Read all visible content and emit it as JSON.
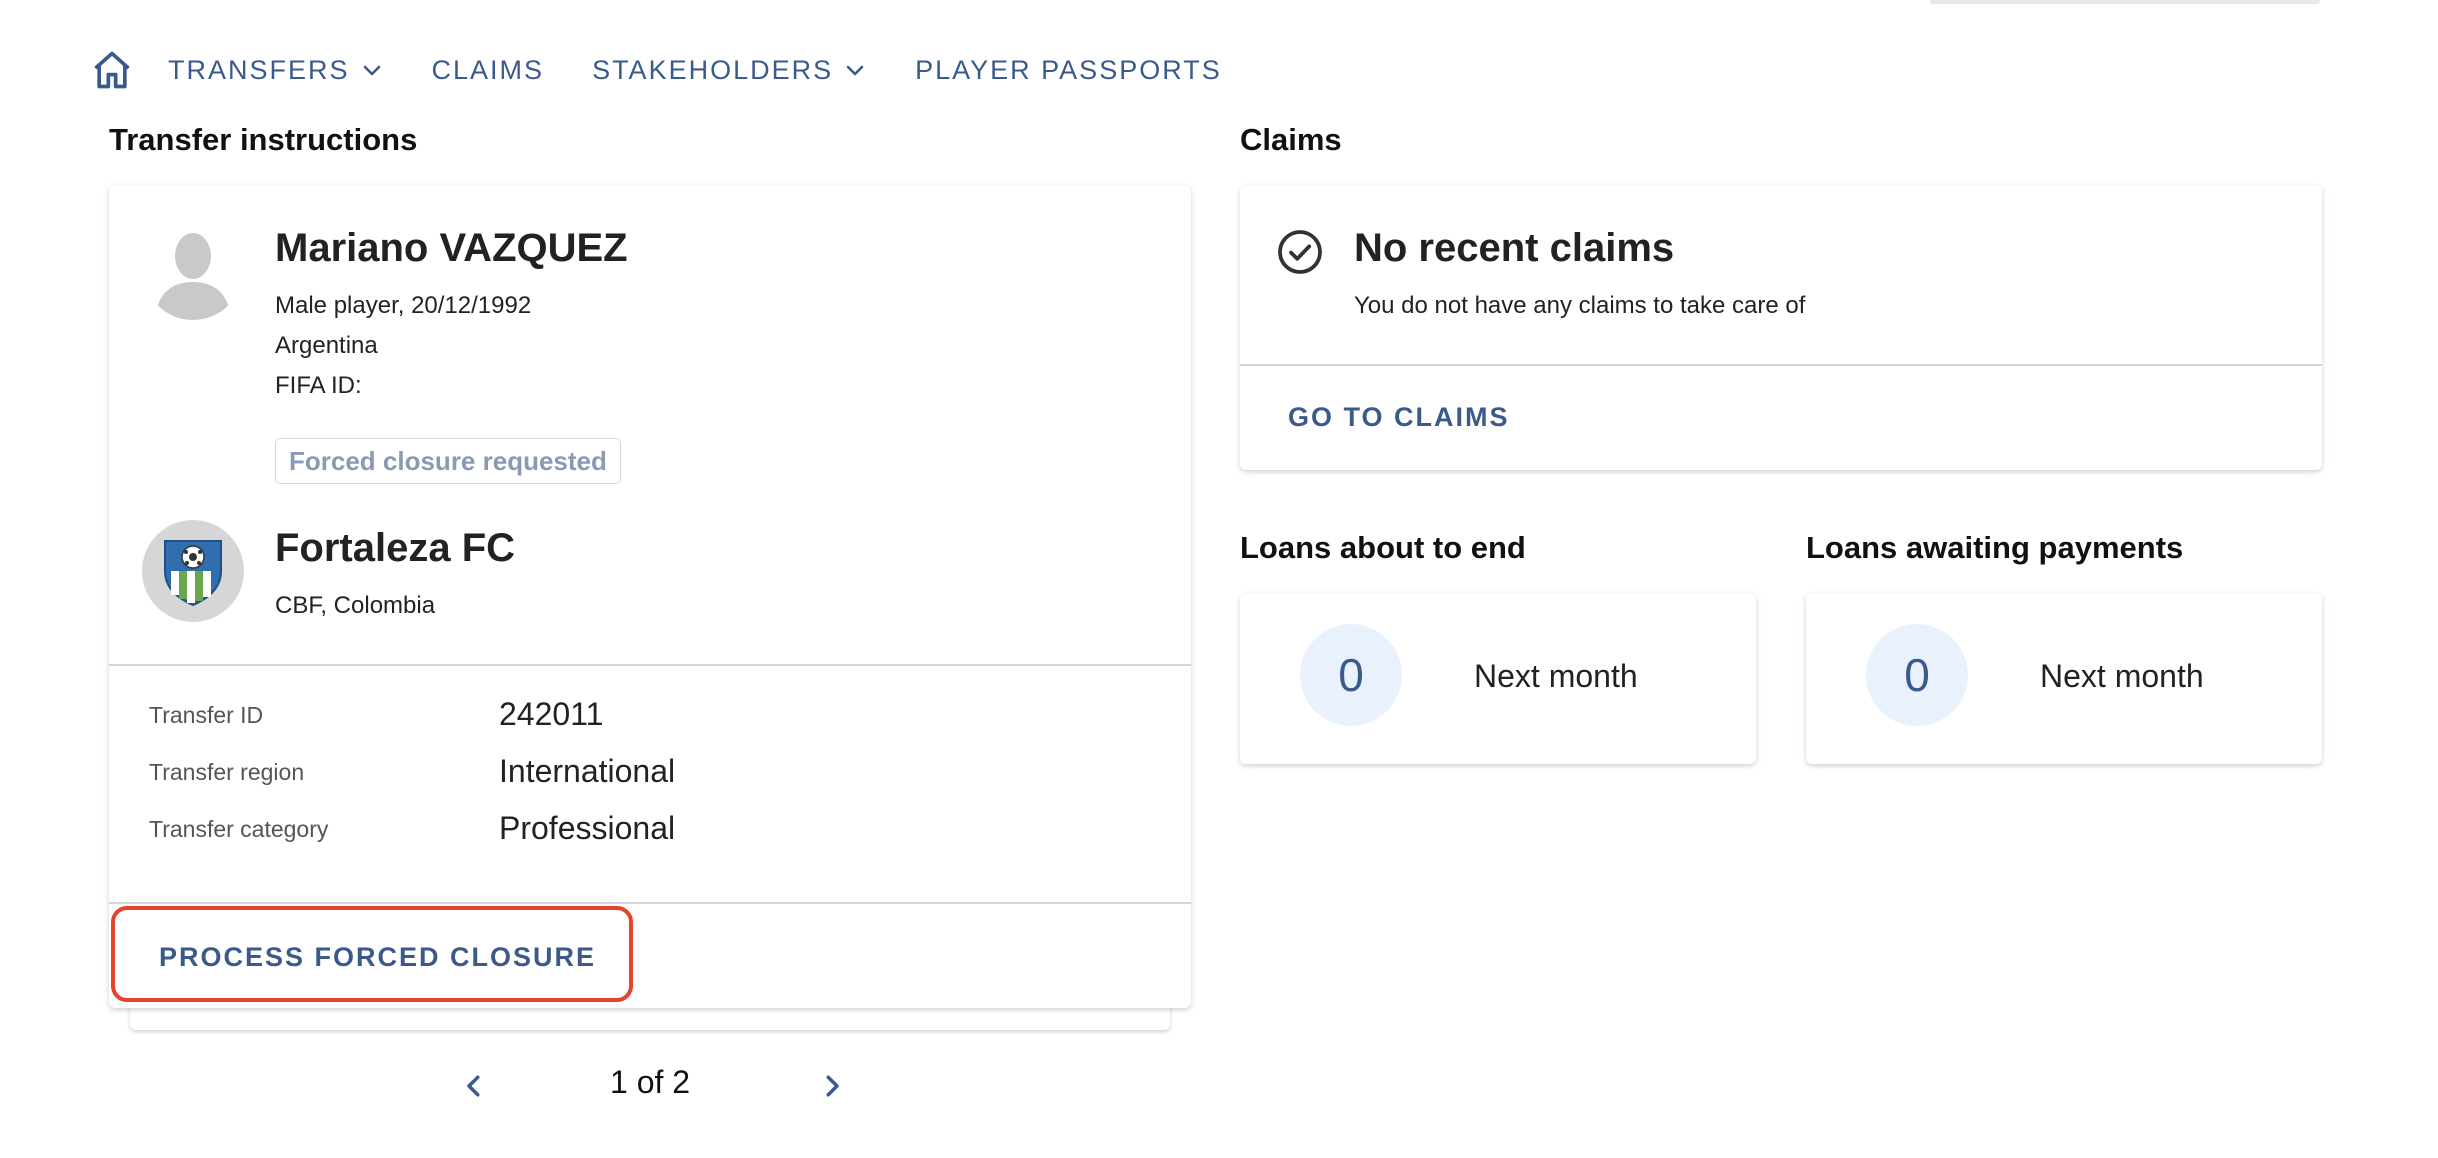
{
  "nav": {
    "items": [
      {
        "label": "TRANSFERS",
        "has_dropdown": true
      },
      {
        "label": "CLAIMS",
        "has_dropdown": false
      },
      {
        "label": "STAKEHOLDERS",
        "has_dropdown": true
      },
      {
        "label": "PLAYER PASSPORTS",
        "has_dropdown": false
      }
    ]
  },
  "transfer_instructions": {
    "title": "Transfer instructions",
    "player": {
      "name": "Mariano VAZQUEZ",
      "info": "Male player, 20/12/1992",
      "nationality": "Argentina",
      "fifa_id": "FIFA ID:"
    },
    "status_badge": "Forced closure requested",
    "club": {
      "name": "Fortaleza FC",
      "association": "CBF, Colombia"
    },
    "details": [
      {
        "label": "Transfer ID",
        "value": "242011"
      },
      {
        "label": "Transfer region",
        "value": "International"
      },
      {
        "label": "Transfer category",
        "value": "Professional"
      }
    ],
    "action_label": "PROCESS FORCED CLOSURE",
    "pagination": {
      "text": "1 of 2"
    }
  },
  "claims": {
    "title": "Claims",
    "empty_title": "No recent claims",
    "empty_subtitle": "You do not have any claims to take care of",
    "button_label": "GO TO CLAIMS"
  },
  "loans_ending": {
    "title": "Loans about to end",
    "count": "0",
    "period": "Next month"
  },
  "loans_payments": {
    "title": "Loans awaiting payments",
    "count": "0",
    "period": "Next month"
  },
  "colors": {
    "accent": "#3b5a8c",
    "highlight": "#e5432b",
    "badge_text": "#8a9ab5",
    "count_circle": "#e9f2fc"
  },
  "icons": [
    "home-icon",
    "chevron-down-icon",
    "person-avatar-icon",
    "club-crest-icon",
    "check-circle-icon",
    "chevron-left-icon",
    "chevron-right-icon"
  ]
}
